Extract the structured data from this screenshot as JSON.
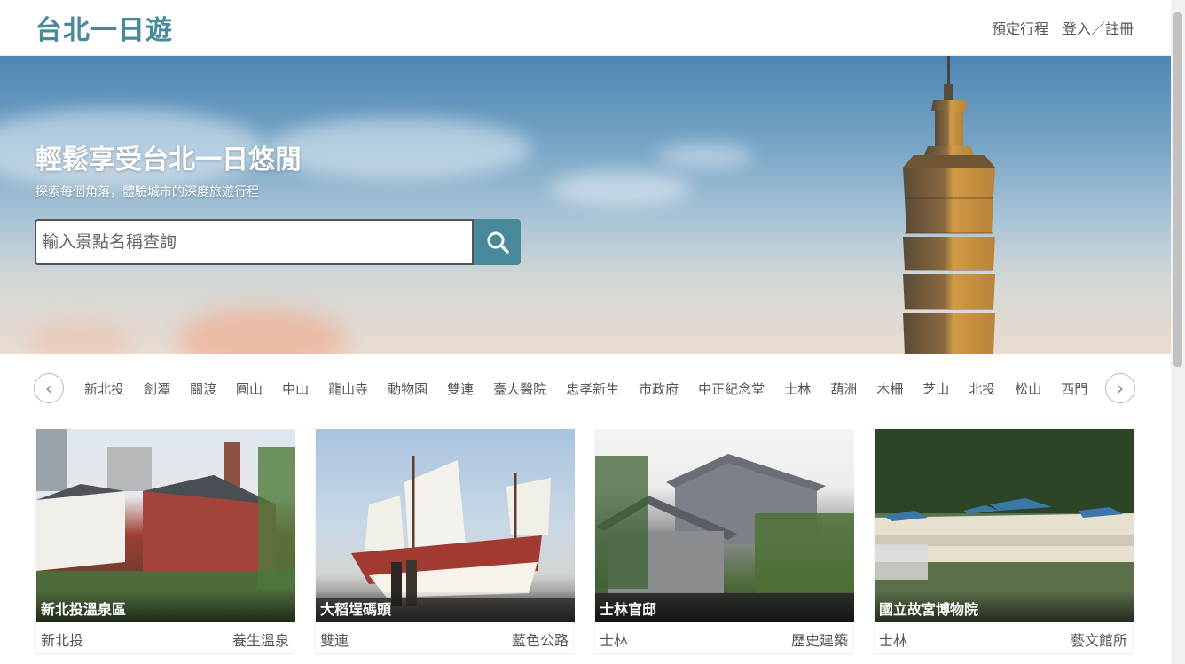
{
  "header": {
    "logo": "台北一日遊",
    "nav": [
      "預定行程",
      "登入／註冊"
    ]
  },
  "hero": {
    "title": "輕鬆享受台北一日悠閒",
    "subtitle": "探索每個角落，體驗城市的深度旅遊行程",
    "search_placeholder": "輸入景點名稱查詢"
  },
  "stations": [
    "新北投",
    "劍潭",
    "關渡",
    "圓山",
    "中山",
    "龍山寺",
    "動物園",
    "雙連",
    "臺大醫院",
    "忠孝新生",
    "市政府",
    "中正紀念堂",
    "士林",
    "葫洲",
    "木柵",
    "芝山",
    "北投",
    "松山",
    "西門"
  ],
  "attractions": [
    {
      "name": "新北投溫泉區",
      "mrt": "新北投",
      "category": "養生溫泉"
    },
    {
      "name": "大稻埕碼頭",
      "mrt": "雙連",
      "category": "藍色公路"
    },
    {
      "name": "士林官邸",
      "mrt": "士林",
      "category": "歷史建築"
    },
    {
      "name": "國立故宮博物院",
      "mrt": "士林",
      "category": "藝文館所"
    }
  ],
  "colors": {
    "brand": "#488a99"
  }
}
